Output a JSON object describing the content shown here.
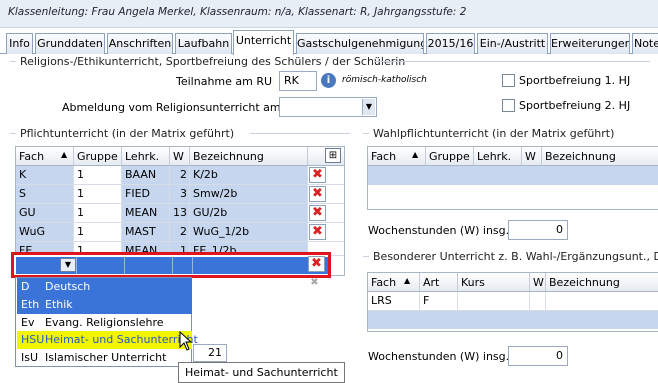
{
  "infobar": {
    "text": "Klassenleitung: Frau Angela Merkel, Klassenraum: n/a, Klassenart: R, Jahrgangsstufe: 2"
  },
  "tabs": [
    "Info",
    "Grunddaten",
    "Anschriften",
    "Laufbahn",
    "Unterricht",
    "Gastschulgenehmigung",
    "2015/16",
    "Ein-/Austritt",
    "Erweiterungen",
    "Note"
  ],
  "religion": {
    "group_title": "Religions-/Ethikunterricht, Sportbefreiung des Schülers / der Schülerin",
    "participation_label": "Teilnahme am RU",
    "participation_value": "RK",
    "participation_desc": "römisch-katholisch",
    "deregistration_label": "Abmeldung vom Religionsunterricht am",
    "deregistration_value": "",
    "sport1_label": "Sportbefreiung 1. HJ",
    "sport2_label": "Sportbefreiung 2. HJ"
  },
  "pflicht": {
    "title": "Pflichtunterricht (in der Matrix geführt)",
    "columns": [
      "Fach",
      "Gruppe",
      "Lehrk.",
      "W",
      "Bezeichnung"
    ],
    "rows": [
      {
        "fach": "K",
        "gruppe": "1",
        "lehrk": "BAAN",
        "w": "2",
        "bez": "K/2b"
      },
      {
        "fach": "S",
        "gruppe": "1",
        "lehrk": "FIED",
        "w": "3",
        "bez": "Smw/2b"
      },
      {
        "fach": "GU",
        "gruppe": "1",
        "lehrk": "MEAN",
        "w": "13",
        "bez": "GU/2b"
      },
      {
        "fach": "WuG",
        "gruppe": "1",
        "lehrk": "MAST",
        "w": "2",
        "bez": "WuG_1/2b"
      },
      {
        "fach": "FE",
        "gruppe": "1",
        "lehrk": "MEAN",
        "w": "1",
        "bez": "FE_1/2b"
      }
    ],
    "total_value": "21",
    "dropdown": [
      {
        "code": "D",
        "name": "Deutsch"
      },
      {
        "code": "Eth",
        "name": "Ethik"
      },
      {
        "code": "Ev",
        "name": "Evang. Religionslehre"
      },
      {
        "code": "HSU",
        "name": "Heimat- und Sachunterricht"
      },
      {
        "code": "IsU",
        "name": "Islamischer Unterricht"
      }
    ],
    "tooltip": "Heimat- und Sachunterricht"
  },
  "wahl": {
    "title": "Wahlpflichtunterricht (in der Matrix geführt)",
    "columns": [
      "Fach",
      "Gruppe",
      "Lehrk.",
      "W",
      "Bezeichnung"
    ],
    "hours_label": "Wochenstunden (W) insg.",
    "hours_value": "0"
  },
  "besonderer": {
    "title": "Besonderer Unterricht z. B. Wahl-/Ergänzungsunt., Diff.",
    "columns": [
      "Fach",
      "Art",
      "Kurs",
      "W",
      "Bezeichnung"
    ],
    "rows": [
      {
        "fach": "LRS",
        "art": "F",
        "kurs": "",
        "w": "",
        "bez": ""
      }
    ],
    "hours_label": "Wochenstunden (W) insg.",
    "hours_value": "0"
  },
  "colors": {
    "highlight_red": "#e0141c",
    "highlight_yellow": "#f2f500",
    "dropdown_selected": "#3b74d8",
    "row_selected": "#c5d6ee"
  }
}
